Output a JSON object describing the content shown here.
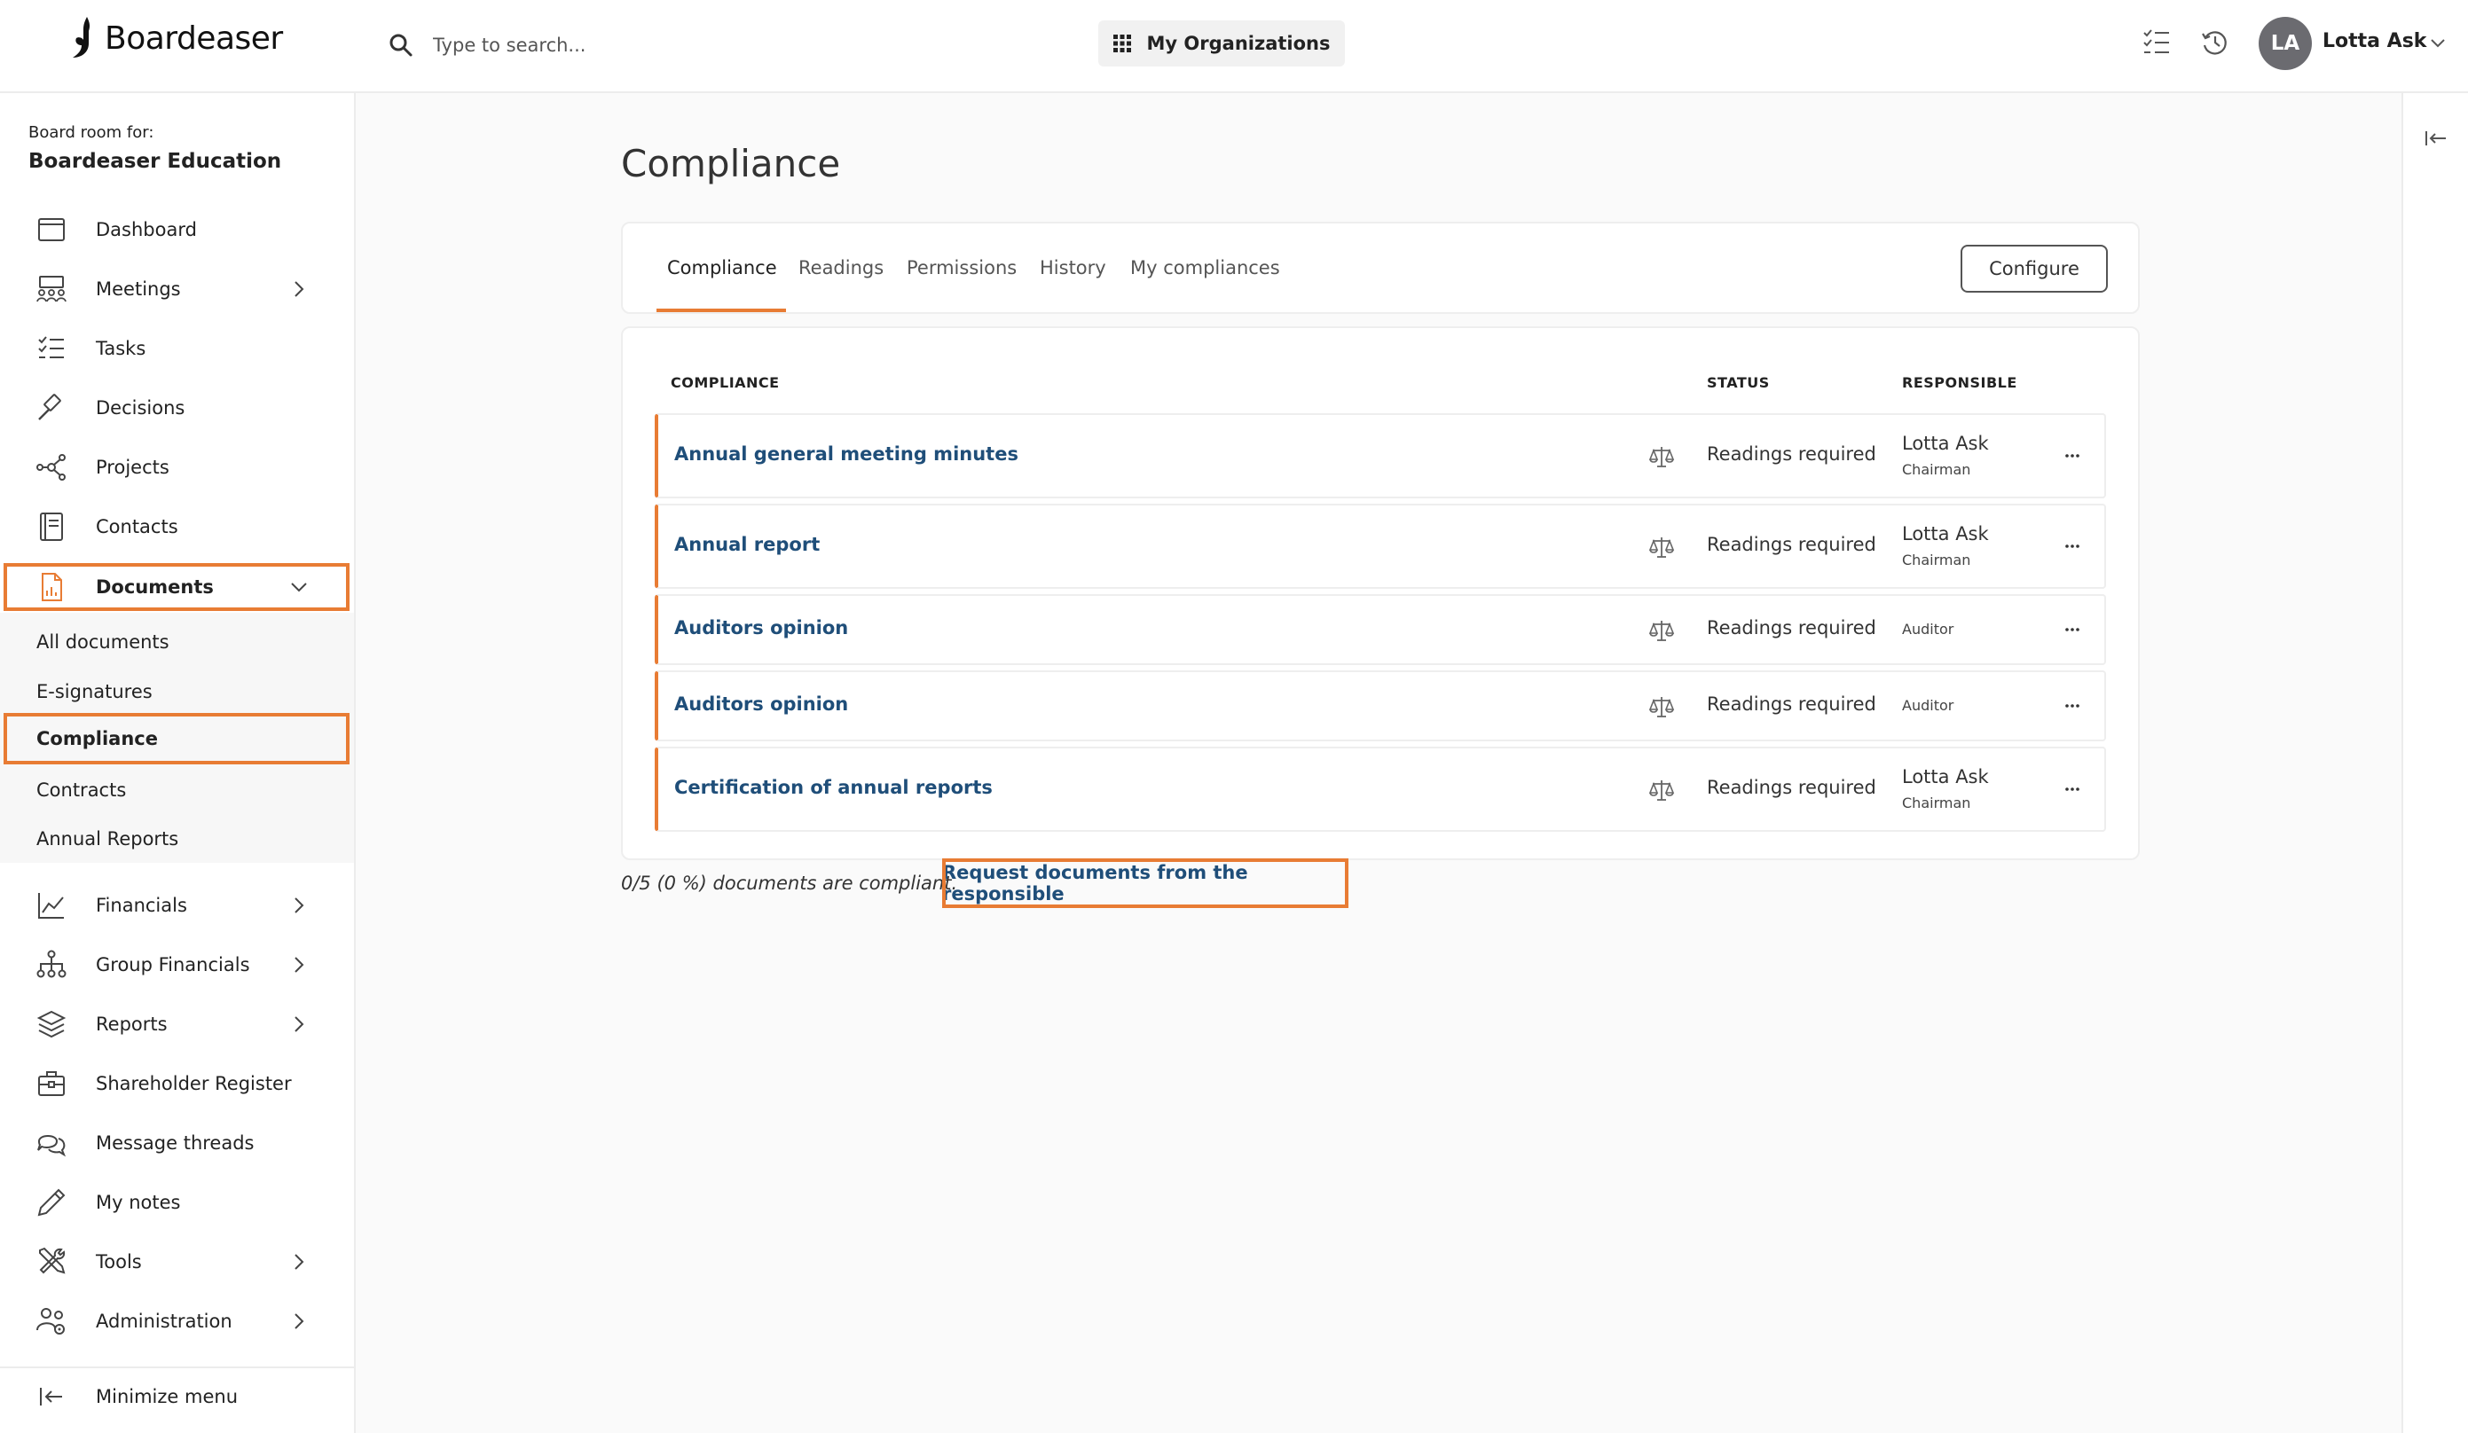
{
  "app": {
    "name": "Boardeaser"
  },
  "colors": {
    "accent": "#e87c34",
    "link": "#1f4e79"
  },
  "search": {
    "placeholder": "Type to search..."
  },
  "header": {
    "orgs_label": "My Organizations",
    "user_initials": "LA",
    "user_name": "Lotta Ask",
    "icons": [
      "tasks-list-icon",
      "history-icon",
      "chevron-down-icon"
    ]
  },
  "sidebar": {
    "board_label": "Board room for:",
    "board_name": "Boardeaser Education",
    "items": [
      {
        "label": "Dashboard",
        "icon": "dashboard-icon"
      },
      {
        "label": "Meetings",
        "icon": "meetings-icon",
        "expandable": true
      },
      {
        "label": "Tasks",
        "icon": "tasks-icon"
      },
      {
        "label": "Decisions",
        "icon": "gavel-icon"
      },
      {
        "label": "Projects",
        "icon": "projects-icon"
      },
      {
        "label": "Contacts",
        "icon": "contacts-icon"
      },
      {
        "label": "Documents",
        "icon": "document-icon",
        "expanded": true
      },
      {
        "label": "Financials",
        "icon": "chart-icon",
        "expandable": true
      },
      {
        "label": "Group Financials",
        "icon": "org-chart-icon",
        "expandable": true
      },
      {
        "label": "Reports",
        "icon": "layers-icon",
        "expandable": true
      },
      {
        "label": "Shareholder Register",
        "icon": "briefcase-icon"
      },
      {
        "label": "Message threads",
        "icon": "chat-icon"
      },
      {
        "label": "My notes",
        "icon": "pencil-icon"
      },
      {
        "label": "Tools",
        "icon": "tools-icon",
        "expandable": true
      },
      {
        "label": "Administration",
        "icon": "users-gear-icon",
        "expandable": true
      }
    ],
    "documents_sub": [
      {
        "label": "All documents"
      },
      {
        "label": "E-signatures"
      },
      {
        "label": "Compliance",
        "active": true
      },
      {
        "label": "Contracts"
      },
      {
        "label": "Annual Reports"
      }
    ],
    "minimize_label": "Minimize menu"
  },
  "main": {
    "title": "Compliance",
    "tabs": [
      {
        "label": "Compliance",
        "active": true
      },
      {
        "label": "Readings"
      },
      {
        "label": "Permissions"
      },
      {
        "label": "History"
      },
      {
        "label": "My compliances"
      }
    ],
    "configure_label": "Configure",
    "table": {
      "headers": {
        "compliance": "COMPLIANCE",
        "status": "STATUS",
        "responsible": "RESPONSIBLE"
      },
      "rows": [
        {
          "name": "Annual general meeting minutes",
          "status": "Readings required",
          "responsible_name": "Lotta Ask",
          "responsible_role": "Chairman"
        },
        {
          "name": "Annual report",
          "status": "Readings required",
          "responsible_name": "Lotta Ask",
          "responsible_role": "Chairman"
        },
        {
          "name": "Auditors opinion",
          "status": "Readings required",
          "responsible_name": "",
          "responsible_role": "Auditor"
        },
        {
          "name": "Auditors opinion",
          "status": "Readings required",
          "responsible_name": "",
          "responsible_role": "Auditor"
        },
        {
          "name": "Certification of annual reports",
          "status": "Readings required",
          "responsible_name": "Lotta Ask",
          "responsible_role": "Chairman"
        }
      ]
    },
    "footer_text": "0/5 (0 %) documents are compliant.",
    "request_link": "Request documents from the responsible"
  }
}
